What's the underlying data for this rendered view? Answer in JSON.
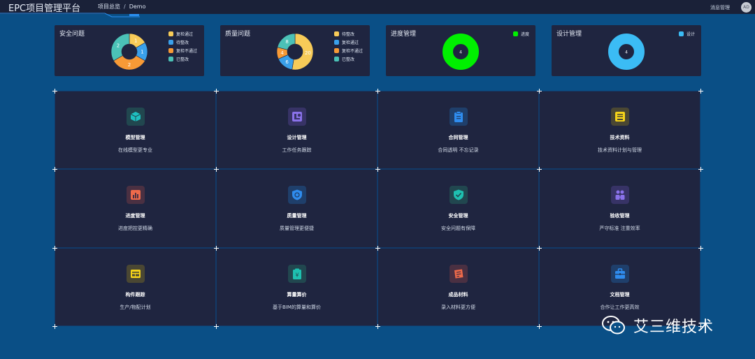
{
  "header": {
    "app_title": "EPC项目管理平台",
    "breadcrumb": [
      "项目总览",
      "Demo"
    ],
    "messages_label": "消息管理",
    "avatar_initials": "AD"
  },
  "charts": [
    {
      "title": "安全问题",
      "chart_data": {
        "type": "pie",
        "style": "donut",
        "labels": [
          "复检通过",
          "待整改",
          "复检不通过",
          "已整改"
        ],
        "values": [
          1,
          1,
          2,
          2
        ],
        "colors": [
          "#f7cb58",
          "#3aa0ea",
          "#f79a36",
          "#4bc1b6"
        ]
      }
    },
    {
      "title": "质量问题",
      "chart_data": {
        "type": "pie",
        "style": "donut",
        "labels": [
          "待整改",
          "复检通过",
          "复检不通过",
          "已整改"
        ],
        "values": [
          20,
          6,
          4,
          8
        ],
        "colors": [
          "#f7cb58",
          "#3aa0ea",
          "#f79a36",
          "#4bc1b6"
        ]
      }
    },
    {
      "title": "进度管理",
      "chart_data": {
        "type": "pie",
        "style": "donut",
        "labels": [
          "进度"
        ],
        "values": [
          4
        ],
        "colors": [
          "#00f000"
        ]
      }
    },
    {
      "title": "设计管理",
      "chart_data": {
        "type": "pie",
        "style": "donut",
        "labels": [
          "设计"
        ],
        "values": [
          4
        ],
        "colors": [
          "#3bbcf5"
        ]
      }
    }
  ],
  "modules": [
    {
      "name": "模型管理",
      "desc": "在线模型更专业",
      "icon": "cube-icon",
      "color": "#1ec0c0",
      "bg": "#21474f"
    },
    {
      "name": "设计管理",
      "desc": "工作任务跟踪",
      "icon": "design-icon",
      "color": "#8a72ea",
      "bg": "#373366"
    },
    {
      "name": "合同管理",
      "desc": "合同透明 不忘记录",
      "icon": "clipboard-icon",
      "color": "#2f8cee",
      "bg": "#1f3f6b"
    },
    {
      "name": "技术资料",
      "desc": "技术资料计划与管理",
      "icon": "book-icon",
      "color": "#f4d21a",
      "bg": "#4a4733"
    },
    {
      "name": "进度管理",
      "desc": "进度把控更精确",
      "icon": "bar-chart-icon",
      "color": "#ee6a4a",
      "bg": "#4a3042"
    },
    {
      "name": "质量管理",
      "desc": "质量管理更便捷",
      "icon": "shield-badge-icon",
      "color": "#2f8cee",
      "bg": "#1f3f6b"
    },
    {
      "name": "安全管理",
      "desc": "安全问题有保障",
      "icon": "shield-check-icon",
      "color": "#1ec0b0",
      "bg": "#21474f"
    },
    {
      "name": "验收管理",
      "desc": "严守标准 注重效率",
      "icon": "people-icon",
      "color": "#8a72ea",
      "bg": "#373366"
    },
    {
      "name": "构件跟踪",
      "desc": "生产/物配计划",
      "icon": "card-icon",
      "color": "#f4d21a",
      "bg": "#4a4733"
    },
    {
      "name": "算量算价",
      "desc": "基于BIM的算量和算价",
      "icon": "price-icon",
      "color": "#1ec0b0",
      "bg": "#21474f"
    },
    {
      "name": "成品材料",
      "desc": "录入材料更方便",
      "icon": "material-icon",
      "color": "#ee6a4a",
      "bg": "#4a3042"
    },
    {
      "name": "文档管理",
      "desc": "合作让工作更高效",
      "icon": "briefcase-icon",
      "color": "#2f8cee",
      "bg": "#1f3f6b"
    }
  ],
  "watermark": "艾三维技术"
}
